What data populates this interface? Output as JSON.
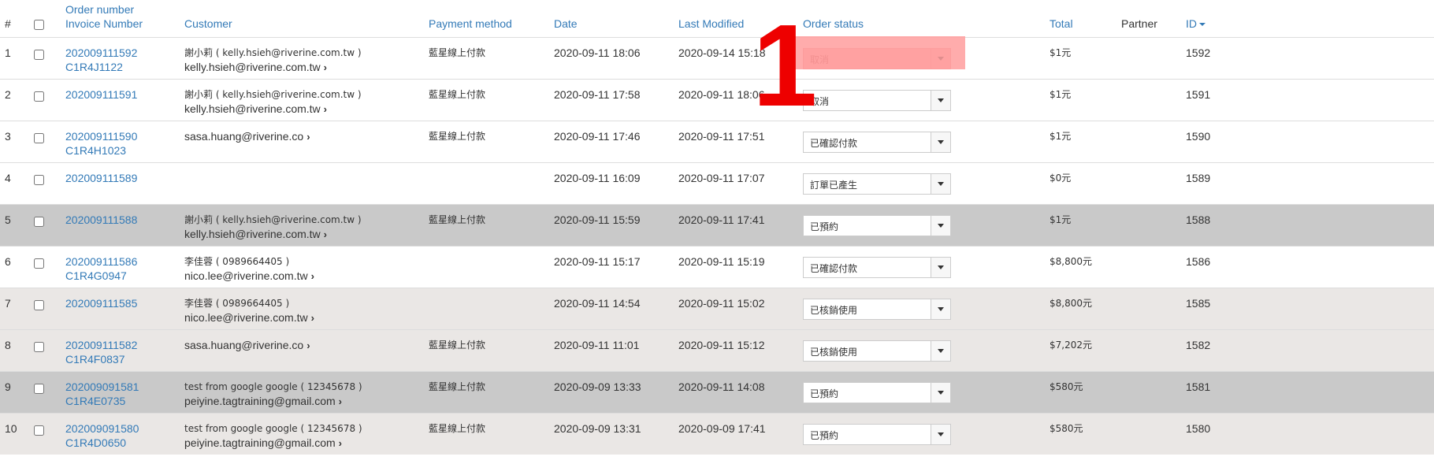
{
  "headers": {
    "index": "#",
    "order_number": "Order number",
    "invoice_number": "Invoice Number",
    "customer": "Customer",
    "payment_method": "Payment method",
    "date": "Date",
    "last_modified": "Last Modified",
    "order_status": "Order status",
    "total": "Total",
    "partner": "Partner",
    "id": "ID"
  },
  "annotation": {
    "label": "1",
    "color": "#ee0000"
  },
  "rows": [
    {
      "idx": "1",
      "order": "202009111592",
      "invoice": "C1R4J1122",
      "cust_name": "謝小莉 ( kelly.hsieh@riverine.com.tw )",
      "cust_email": "kelly.hsieh@riverine.com.tw",
      "payment": "藍星線上付款",
      "date": "2020-09-11 18:06",
      "modified": "2020-09-14 15:18",
      "status": "取消",
      "total": "$1元",
      "partner": "",
      "id": "1592"
    },
    {
      "idx": "2",
      "order": "202009111591",
      "invoice": "",
      "cust_name": "謝小莉 ( kelly.hsieh@riverine.com.tw )",
      "cust_email": "kelly.hsieh@riverine.com.tw",
      "payment": "藍星線上付款",
      "date": "2020-09-11 17:58",
      "modified": "2020-09-11 18:06",
      "status": "取消",
      "total": "$1元",
      "partner": "",
      "id": "1591"
    },
    {
      "idx": "3",
      "order": "202009111590",
      "invoice": "C1R4H1023",
      "cust_name": "",
      "cust_email": "sasa.huang@riverine.co",
      "payment": "藍星線上付款",
      "date": "2020-09-11 17:46",
      "modified": "2020-09-11 17:51",
      "status": "已確認付款",
      "total": "$1元",
      "partner": "",
      "id": "1590"
    },
    {
      "idx": "4",
      "order": "202009111589",
      "invoice": "",
      "cust_name": "",
      "cust_email": "",
      "payment": "",
      "date": "2020-09-11 16:09",
      "modified": "2020-09-11 17:07",
      "status": "訂單已產生",
      "total": "$0元",
      "partner": "",
      "id": "1589"
    },
    {
      "idx": "5",
      "order": "202009111588",
      "invoice": "",
      "cust_name": "謝小莉 ( kelly.hsieh@riverine.com.tw )",
      "cust_email": "kelly.hsieh@riverine.com.tw",
      "payment": "藍星線上付款",
      "date": "2020-09-11 15:59",
      "modified": "2020-09-11 17:41",
      "status": "已預約",
      "total": "$1元",
      "partner": "",
      "id": "1588"
    },
    {
      "idx": "6",
      "order": "202009111586",
      "invoice": "C1R4G0947",
      "cust_name": "李佳蓉 ( 0989664405 )",
      "cust_email": "nico.lee@riverine.com.tw",
      "payment": "",
      "date": "2020-09-11 15:17",
      "modified": "2020-09-11 15:19",
      "status": "已確認付款",
      "total": "$8,800元",
      "partner": "",
      "id": "1586"
    },
    {
      "idx": "7",
      "order": "202009111585",
      "invoice": "",
      "cust_name": "李佳蓉 ( 0989664405 )",
      "cust_email": "nico.lee@riverine.com.tw",
      "payment": "",
      "date": "2020-09-11 14:54",
      "modified": "2020-09-11 15:02",
      "status": "已核銷使用",
      "total": "$8,800元",
      "partner": "",
      "id": "1585"
    },
    {
      "idx": "8",
      "order": "202009111582",
      "invoice": "C1R4F0837",
      "cust_name": "",
      "cust_email": "sasa.huang@riverine.co",
      "payment": "藍星線上付款",
      "date": "2020-09-11 11:01",
      "modified": "2020-09-11 15:12",
      "status": "已核銷使用",
      "total": "$7,202元",
      "partner": "",
      "id": "1582"
    },
    {
      "idx": "9",
      "order": "202009091581",
      "invoice": "C1R4E0735",
      "cust_name": "test from google google ( 12345678 )",
      "cust_email": "peiyine.tagtraining@gmail.com",
      "payment": "藍星線上付款",
      "date": "2020-09-09 13:33",
      "modified": "2020-09-11 14:08",
      "status": "已預約",
      "total": "$580元",
      "partner": "",
      "id": "1581"
    },
    {
      "idx": "10",
      "order": "202009091580",
      "invoice": "C1R4D0650",
      "cust_name": "test from google google ( 12345678 )",
      "cust_email": "peiyine.tagtraining@gmail.com",
      "payment": "藍星線上付款",
      "date": "2020-09-09 13:31",
      "modified": "2020-09-09 17:41",
      "status": "已預約",
      "total": "$580元",
      "partner": "",
      "id": "1580"
    }
  ],
  "row_shading": [
    "",
    "",
    "",
    "",
    "dark",
    "",
    "light",
    "light",
    "dark",
    "light"
  ],
  "highlighted_row": 0
}
